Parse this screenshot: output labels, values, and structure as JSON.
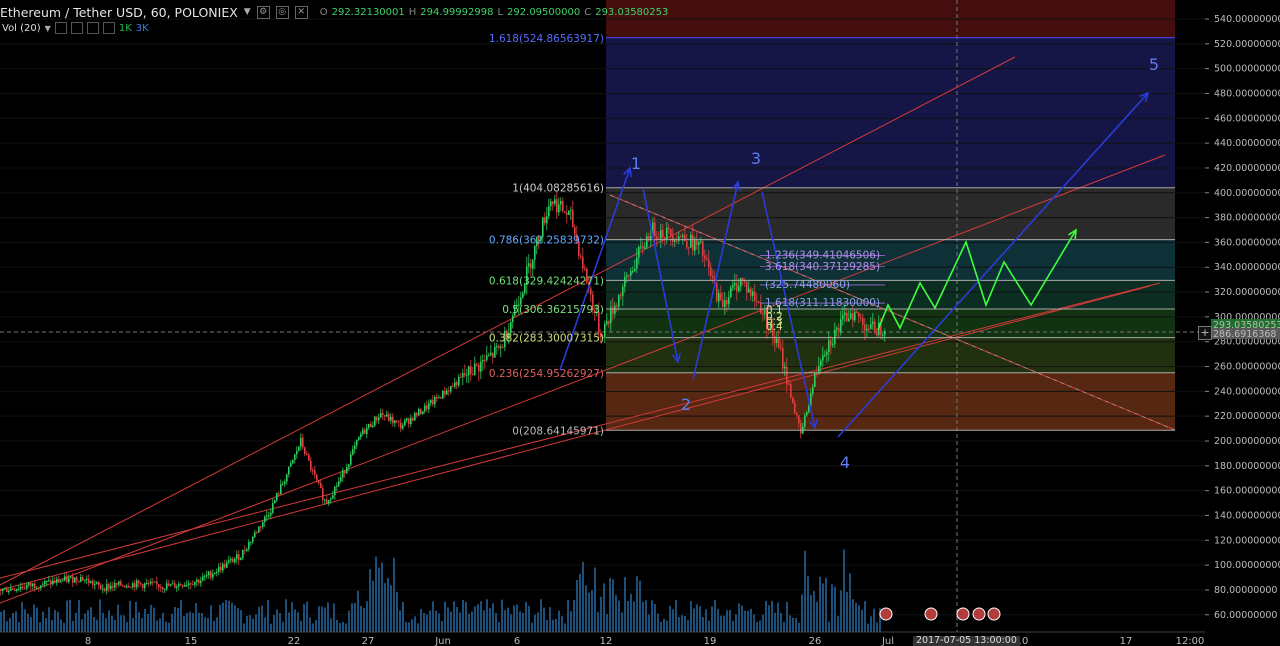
{
  "header": {
    "symbol": "Ethereum / Tether USD, 60, POLONIEX",
    "o_label": "O",
    "o_value": "292.32130001",
    "h_label": "H",
    "h_value": "294.99992998",
    "l_label": "L",
    "l_value": "292.09500000",
    "c_label": "C",
    "c_value": "293.03580253"
  },
  "volume": {
    "label": "Vol (20)",
    "v1": "1K",
    "v2": "3K"
  },
  "crosshair_time": "2017-07-05 13:00:00",
  "colors": {
    "up": "#2fcf5f",
    "down": "#e04040",
    "fib_band": "#4070ff",
    "trend": "#d23a3a",
    "projection": "#2a3cd8",
    "forecast": "#3cff3c",
    "volume": "#1c4f7a"
  },
  "chart_data": {
    "type": "candlestick",
    "title": "Ethereum / Tether USD, 60, POLONIEX",
    "y_axis": {
      "ticks": [
        "540.00000000",
        "520.00000000",
        "500.00000000",
        "480.00000000",
        "460.00000000",
        "440.00000000",
        "420.00000000",
        "400.00000000",
        "380.00000000",
        "360.00000000",
        "340.00000000",
        "320.00000000",
        "300.00000000",
        "280.00000000",
        "260.00000000",
        "240.00000000",
        "220.00000000",
        "200.00000000",
        "180.00000000",
        "160.00000000",
        "140.00000000",
        "120.00000000",
        "100.00000000",
        "80.00000000",
        "60.00000000"
      ],
      "range": [
        55,
        548
      ],
      "price_tags": [
        "293.03580253",
        "286.6916368"
      ]
    },
    "x_axis": {
      "ticks": [
        "8",
        "15",
        "22",
        "27",
        "Jun",
        "6",
        "12",
        "19",
        "26",
        "Jul",
        "10",
        "17",
        "12:00"
      ]
    },
    "price_path": [
      [
        0,
        80
      ],
      [
        0.05,
        86
      ],
      [
        0.08,
        90
      ],
      [
        0.1,
        82
      ],
      [
        0.13,
        85
      ],
      [
        0.17,
        83
      ],
      [
        0.2,
        88
      ],
      [
        0.24,
        108
      ],
      [
        0.27,
        145
      ],
      [
        0.29,
        180
      ],
      [
        0.3,
        200
      ],
      [
        0.31,
        178
      ],
      [
        0.325,
        150
      ],
      [
        0.34,
        170
      ],
      [
        0.36,
        205
      ],
      [
        0.38,
        222
      ],
      [
        0.4,
        212
      ],
      [
        0.43,
        230
      ],
      [
        0.46,
        250
      ],
      [
        0.48,
        262
      ],
      [
        0.5,
        275
      ],
      [
        0.52,
        320
      ],
      [
        0.55,
        395
      ],
      [
        0.57,
        380
      ],
      [
        0.6,
        285
      ],
      [
        0.62,
        320
      ],
      [
        0.65,
        370
      ],
      [
        0.68,
        365
      ],
      [
        0.7,
        355
      ],
      [
        0.72,
        310
      ],
      [
        0.74,
        330
      ],
      [
        0.76,
        308
      ],
      [
        0.78,
        270
      ],
      [
        0.8,
        205
      ],
      [
        0.82,
        270
      ],
      [
        0.85,
        305
      ],
      [
        0.87,
        290
      ],
      [
        0.89,
        293
      ]
    ],
    "fibonacci": [
      {
        "label": "1.618(524.86563917)",
        "value": 524.86563917
      },
      {
        "label": "1(404.08285616)",
        "value": 404.08285616
      },
      {
        "label": "0.786(362.25839732)",
        "value": 362.25839732
      },
      {
        "label": "0.618(329.42424271)",
        "value": 329.42424271
      },
      {
        "label": "0.5(306.36215793)",
        "value": 306.36215793
      },
      {
        "label": "0.382(283.30007315)",
        "value": 283.30007315
      },
      {
        "label": "0.236(254.95262927)",
        "value": 254.95262927
      },
      {
        "label": "0(208.64145971)",
        "value": 208.64145971
      }
    ],
    "fib_extensions": [
      {
        "label": "1.236(349.41046506)",
        "value": 349.41046506
      },
      {
        "label": "3.618(340.37129285)",
        "value": 340.37129285
      },
      {
        "label": "(325.74480060)",
        "value": 325.7448006
      },
      {
        "label": "1.618(311.11830000)",
        "value": 311.1183
      }
    ],
    "elliott_waves": [
      {
        "label": "1",
        "value": 415
      },
      {
        "label": "2",
        "value": 230
      },
      {
        "label": "3",
        "value": 415
      },
      {
        "label": "4",
        "value": 182
      },
      {
        "label": "5",
        "value": 502
      }
    ]
  }
}
